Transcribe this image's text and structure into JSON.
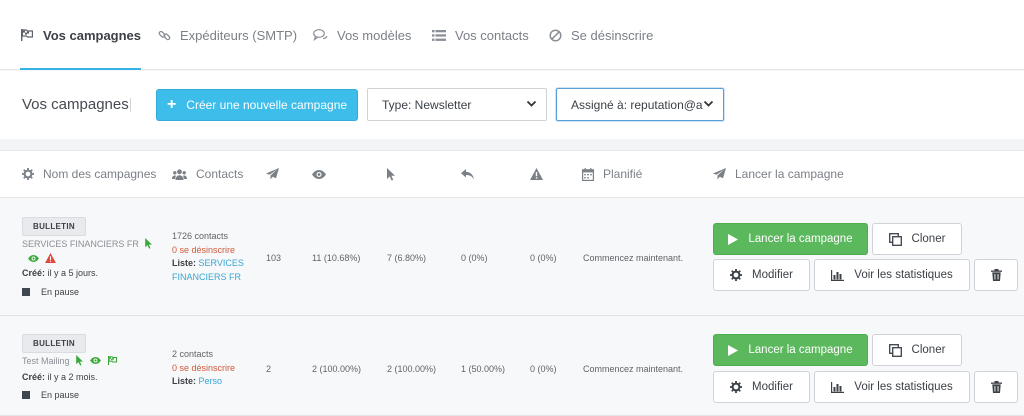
{
  "nav": {
    "tabs": [
      {
        "label": "Vos campagnes",
        "icon": "flag-icon",
        "active": true
      },
      {
        "label": "Expéditeurs (SMTP)",
        "icon": "link-icon"
      },
      {
        "label": "Vos modèles",
        "icon": "comments-icon"
      },
      {
        "label": "Vos contacts",
        "icon": "list-icon"
      },
      {
        "label": "Se désinscrire",
        "icon": "ban-icon"
      }
    ]
  },
  "toolbar": {
    "title": "Vos campagnes",
    "create_label": "Créer une nouvelle campagne",
    "type_select": "Type: Newsletter",
    "assign_select": "Assigné à: reputation@av"
  },
  "columns": {
    "name": "Nom des campagnes",
    "contacts": "Contacts",
    "scheduled": "Planifié",
    "launch": "Lancer la campagne"
  },
  "campaigns": [
    {
      "badge": "BULLETIN",
      "name": "SERVICES FINANCIERS FR",
      "created_label": "Créé:",
      "created": "il y a 5 jours.",
      "status": "En pause",
      "contacts": "1726 contacts",
      "unsubscribed": "0 se désinscrire",
      "list_label": "Liste:",
      "list_name": "SERVICES FINANCIERS FR",
      "sent": "103",
      "opened": "11 (10.68%)",
      "clicked": "7 (6.80%)",
      "replied": "0 (0%)",
      "bounced": "0 (0%)",
      "scheduled": "Commencez maintenant."
    },
    {
      "badge": "BULLETIN",
      "name": "Test Mailing",
      "created_label": "Créé:",
      "created": "il y a 2 mois.",
      "status": "En pause",
      "contacts": "2 contacts",
      "unsubscribed": "0 se désinscrire",
      "list_label": "Liste:",
      "list_name": "Perso",
      "sent": "2",
      "opened": "2 (100.00%)",
      "clicked": "2 (100.00%)",
      "replied": "1 (50.00%)",
      "bounced": "0 (0%)",
      "scheduled": "Commencez maintenant."
    }
  ],
  "actions": {
    "launch": "Lancer la campagne",
    "clone": "Cloner",
    "edit": "Modifier",
    "stats": "Voir les statistiques"
  },
  "colors": {
    "accent": "#3dbde9",
    "launch_green": "#5cb85c",
    "unsub_red": "#d05a3a",
    "link_blue": "#38a6d6"
  }
}
